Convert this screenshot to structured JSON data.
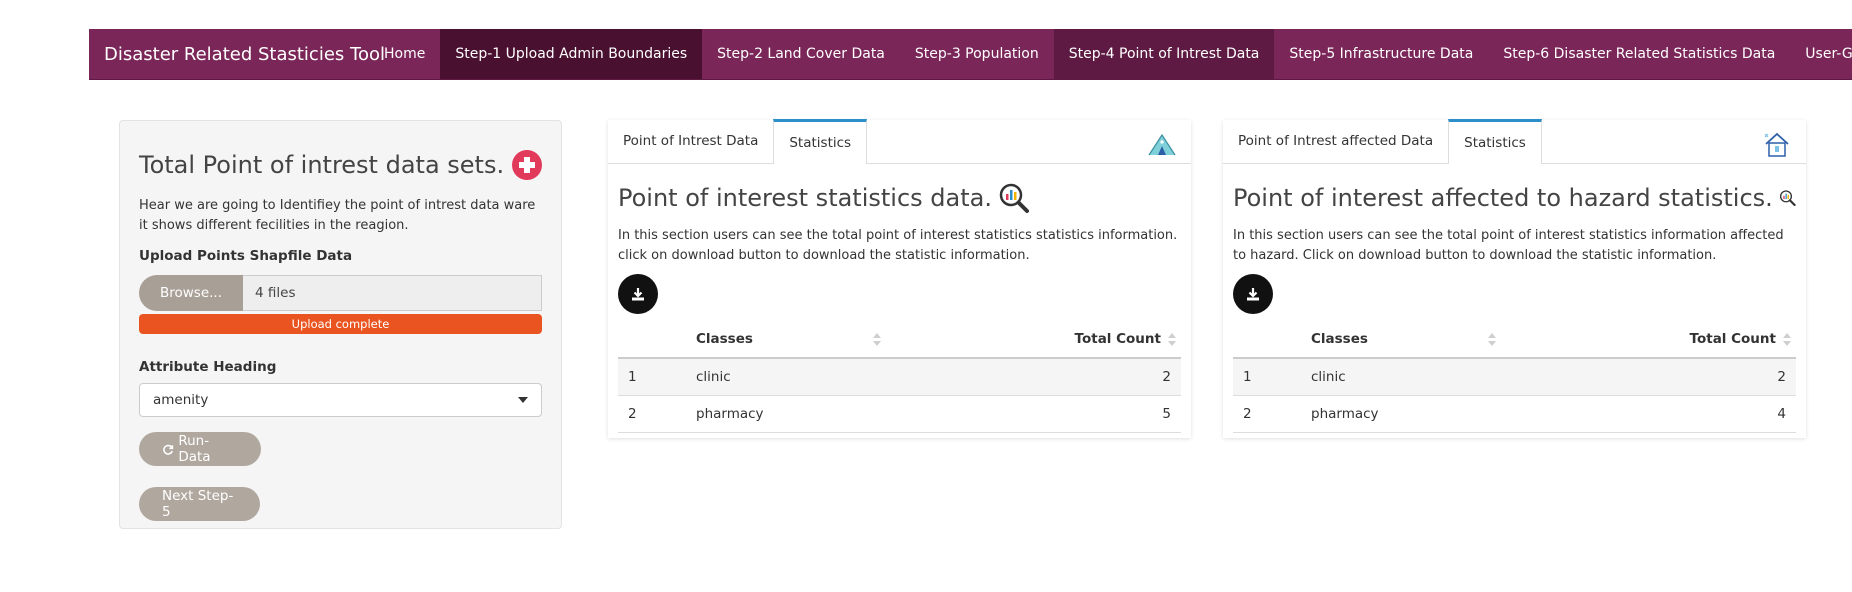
{
  "navbar": {
    "brand": "Disaster Related Stasticies Tool",
    "items": [
      {
        "label": "Home"
      },
      {
        "label": "Step-1 Upload Admin Boundaries"
      },
      {
        "label": "Step-2 Land Cover Data"
      },
      {
        "label": "Step-3 Population"
      },
      {
        "label": "Step-4 Point of Intrest Data"
      },
      {
        "label": "Step-5 Infrastructure Data"
      },
      {
        "label": "Step-6 Disaster Related Statistics Data"
      },
      {
        "label": "User-Guide"
      }
    ]
  },
  "sidebar": {
    "title": "Total Point of intrest data sets.",
    "description": "Hear we are going to Identifiey the point of intrest data ware it shows different fecilities in the reagion.",
    "upload_label": "Upload Points Shapfile Data",
    "browse_label": "Browse...",
    "file_value": "4 files",
    "progress_text": "Upload complete",
    "attribute_label": "Attribute Heading",
    "attribute_value": "amenity",
    "run_label": "Run-Data",
    "next_label": "Next Step-5"
  },
  "panel_poi": {
    "tabs": [
      "Point of Intrest Data",
      "Statistics"
    ],
    "title": "Point of interest statistics data.",
    "description": "In this section users can see the total point of interest statistics statistics information. click on download button to download the statistic information.",
    "columns": [
      "",
      "Classes",
      "Total Count"
    ],
    "rows": [
      [
        "1",
        "clinic",
        "2"
      ],
      [
        "2",
        "pharmacy",
        "5"
      ]
    ]
  },
  "panel_hazard": {
    "tabs": [
      "Point of Intrest affected Data",
      "Statistics"
    ],
    "title": "Point of interest affected to hazard statistics.",
    "description": "In this section users can see the total point of interest statistics information affected to hazard. Click on download button to download the statistic information.",
    "columns": [
      "",
      "Classes",
      "Total Count"
    ],
    "rows": [
      [
        "1",
        "clinic",
        "2"
      ],
      [
        "2",
        "pharmacy",
        "4"
      ]
    ]
  },
  "colors": {
    "navbar": "#7b2658",
    "nav_active": "#4a1030",
    "progress": "#e95420",
    "tab_accent": "#2c8fc9",
    "button": "#b0a89f"
  },
  "icons": [
    "plus-icon",
    "caret-down-icon",
    "refresh-icon",
    "magnifier-chart-icon",
    "download-icon",
    "tent-icon",
    "house-icon",
    "sort-icon"
  ]
}
